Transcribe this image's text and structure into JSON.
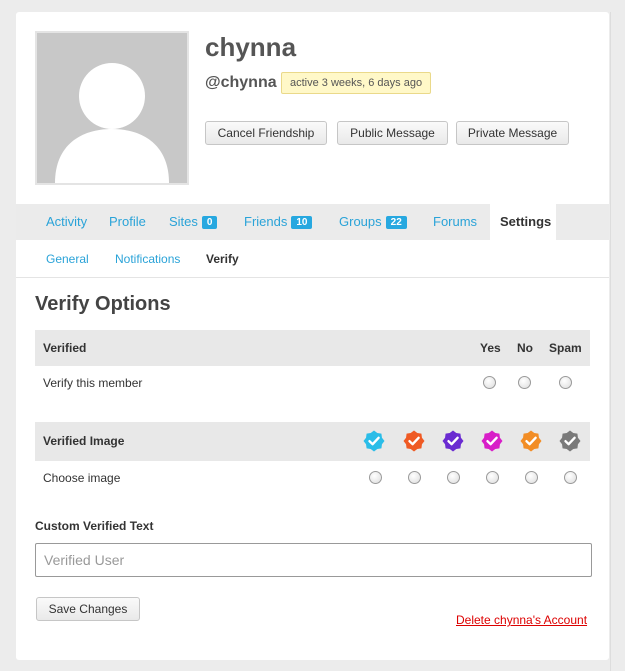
{
  "profile": {
    "display_name": "chynna",
    "handle": "@chynna",
    "activity": "active 3 weeks, 6 days ago",
    "buttons": {
      "cancel_friendship": "Cancel Friendship",
      "public_message": "Public Message",
      "private_message": "Private Message"
    }
  },
  "tabs": [
    {
      "label": "Activity"
    },
    {
      "label": "Profile"
    },
    {
      "label": "Sites",
      "count": "0"
    },
    {
      "label": "Friends",
      "count": "10"
    },
    {
      "label": "Groups",
      "count": "22"
    },
    {
      "label": "Forums"
    },
    {
      "label": "Settings",
      "active": true
    }
  ],
  "subtabs": [
    {
      "label": "General"
    },
    {
      "label": "Notifications"
    },
    {
      "label": "Verify",
      "active": true
    }
  ],
  "verify": {
    "title": "Verify Options",
    "table1": {
      "header": "Verified",
      "columns": [
        "Yes",
        "No",
        "Spam"
      ],
      "row_label": "Verify this member"
    },
    "table2": {
      "header": "Verified Image",
      "badge_colors": [
        "#2bbde8",
        "#ef5a24",
        "#6a2bd1",
        "#d81ec8",
        "#f28d25",
        "#7a7a7a"
      ],
      "row_label": "Choose image"
    },
    "custom_text_label": "Custom Verified Text",
    "custom_text_placeholder": "Verified User",
    "save_label": "Save Changes",
    "delete_label": "Delete chynna's Account"
  }
}
